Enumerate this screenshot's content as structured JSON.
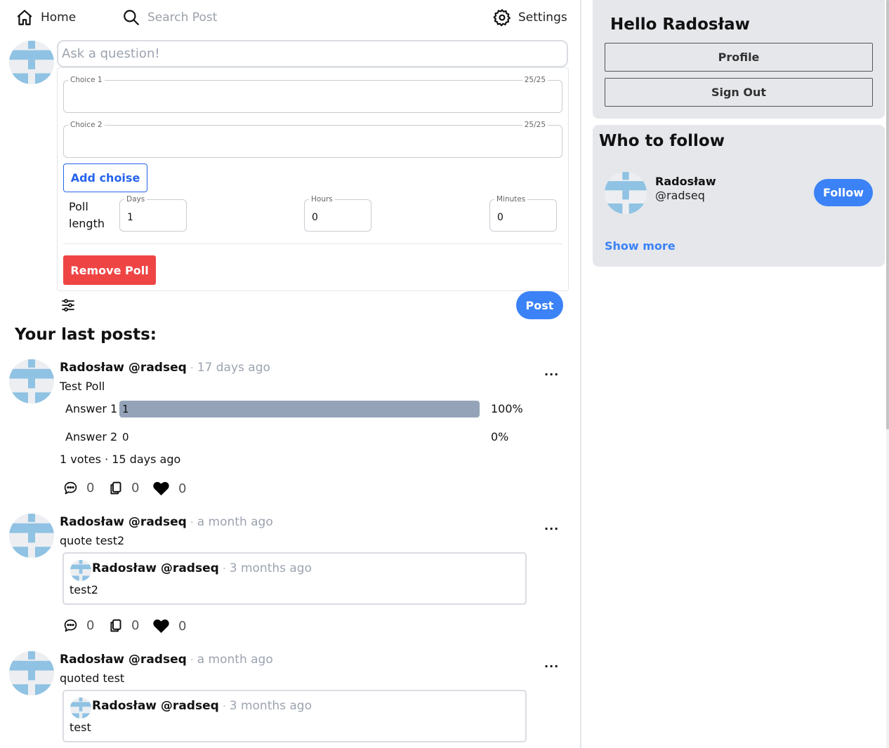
{
  "nav": {
    "home_label": "Home",
    "search_placeholder": "Search Post",
    "settings_label": "Settings"
  },
  "composer": {
    "ask_placeholder": "Ask a question!",
    "choices": [
      {
        "label": "Choice 1",
        "counter": "25/25",
        "value": ""
      },
      {
        "label": "Choice 2",
        "counter": "25/25",
        "value": ""
      }
    ],
    "add_choice_label": "Add choise",
    "poll_length_label": "Poll length",
    "days_label": "Days",
    "days_value": "1",
    "hours_label": "Hours",
    "hours_value": "0",
    "minutes_label": "Minutes",
    "minutes_value": "0",
    "remove_poll_label": "Remove Poll",
    "post_label": "Post"
  },
  "feed": {
    "title": "Your last posts:",
    "posts": [
      {
        "author": "Radosław @radseq",
        "separator": "·",
        "time": "17 days ago",
        "text": "Test Poll",
        "more": "...",
        "poll": {
          "answers": [
            {
              "label": "Answer 1",
              "count": "1",
              "percent": "100%",
              "fill": 1.0
            },
            {
              "label": "Answer 2",
              "count": "0",
              "percent": "0%",
              "fill": 0.0
            }
          ],
          "summary": "1 votes · 15 days ago"
        },
        "comments": "0",
        "retweets": "0",
        "likes": "0"
      },
      {
        "author": "Radosław @radseq",
        "separator": "·",
        "time": "a month ago",
        "text": "quote test2",
        "more": "...",
        "quote": {
          "author": "Radosław @radseq",
          "separator": "·",
          "time": "3 months ago",
          "text": "test2"
        },
        "comments": "0",
        "retweets": "0",
        "likes": "0"
      },
      {
        "author": "Radosław @radseq",
        "separator": "·",
        "time": "a month ago",
        "text": "quoted test",
        "more": "...",
        "quote": {
          "author": "Radosław @radseq",
          "separator": "·",
          "time": "3 months ago",
          "text": "test"
        }
      }
    ]
  },
  "sidebar": {
    "greeting": "Hello Radosław",
    "profile_label": "Profile",
    "signout_label": "Sign Out",
    "who_to_follow_title": "Who to follow",
    "suggestion": {
      "name": "Radosław",
      "handle": "@radseq",
      "follow_label": "Follow"
    },
    "show_more_label": "Show more"
  },
  "colors": {
    "accent_blue": "#3b82f6",
    "danger_red": "#ef4444",
    "poll_bar": "#94a3b8",
    "card_bg": "#e5e7eb",
    "avatar_blue": "#8fc2e3"
  }
}
